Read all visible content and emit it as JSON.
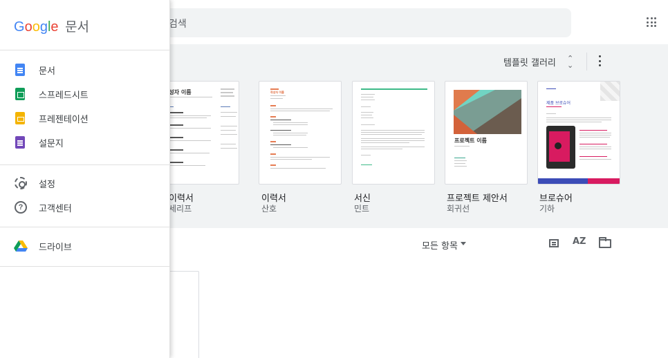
{
  "header": {
    "search_placeholder": "검색",
    "apps_icon": "apps-grid-icon"
  },
  "gallery": {
    "toggle_label": "템플릿 갤러리",
    "toggle_icon": "unfold-icon",
    "more_icon": "more-vert-icon",
    "templates": [
      {
        "title": "이력서",
        "subtitle": "세리프",
        "thumb_heading": "작성자 이름"
      },
      {
        "title": "이력서",
        "subtitle": "산호",
        "thumb_heading": "작성자 이름"
      },
      {
        "title": "서신",
        "subtitle": "민트",
        "thumb_heading": ""
      },
      {
        "title": "프로젝트 제안서",
        "subtitle": "회귀선",
        "thumb_heading": "프로젝트 이름"
      },
      {
        "title": "브로슈어",
        "subtitle": "기하",
        "thumb_heading": "제품 브로슈어"
      }
    ]
  },
  "recent": {
    "filter_label": "모든 항목",
    "sort_label": "AZ"
  },
  "drawer": {
    "brand": {
      "letters": [
        "G",
        "o",
        "o",
        "g",
        "l",
        "e"
      ],
      "product": "문서"
    },
    "apps": [
      {
        "label": "문서",
        "icon": "docs-icon"
      },
      {
        "label": "스프레드시트",
        "icon": "sheets-icon"
      },
      {
        "label": "프레젠테이션",
        "icon": "slides-icon"
      },
      {
        "label": "설문지",
        "icon": "forms-icon"
      }
    ],
    "settings": [
      {
        "label": "설정",
        "icon": "gear-icon"
      },
      {
        "label": "고객센터",
        "icon": "help-icon"
      }
    ],
    "drive": {
      "label": "드라이브",
      "icon": "drive-icon"
    },
    "help_glyph": "?"
  },
  "colors": {
    "docs": "#4285f4",
    "sheets": "#0f9d58",
    "slides": "#f4b400",
    "forms": "#7248b9",
    "band": "#f1f3f4"
  }
}
